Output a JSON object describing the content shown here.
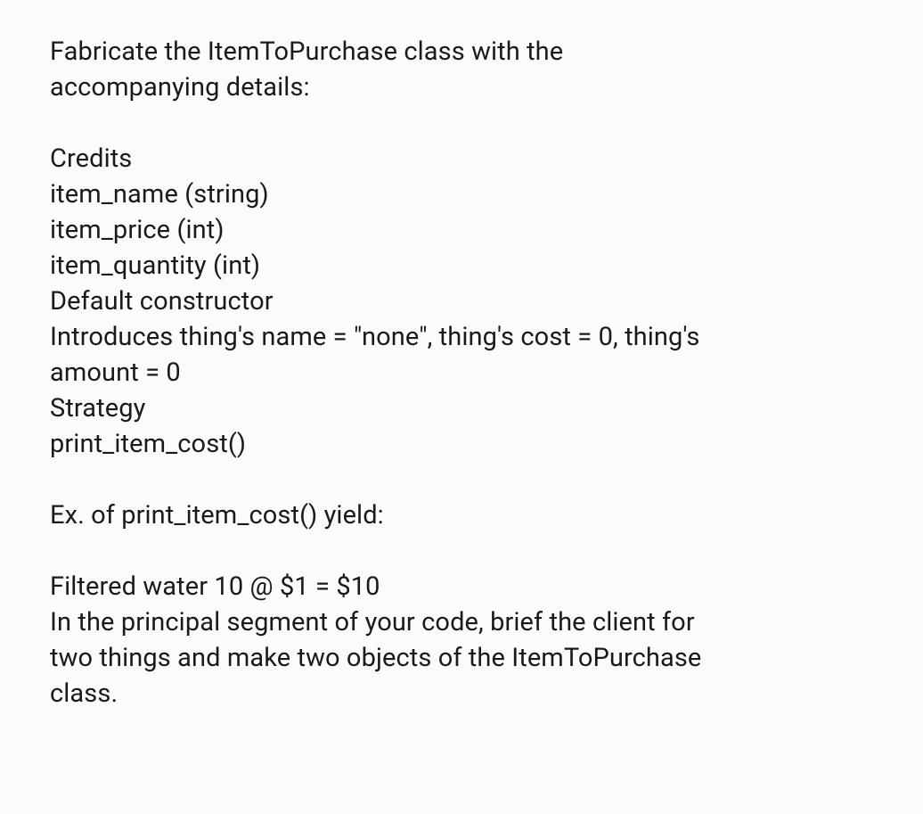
{
  "para1": {
    "line1": "Fabricate the ItemToPurchase class with the",
    "line2": "accompanying details:"
  },
  "para2": {
    "line1": "Credits",
    "line2": "item_name (string)",
    "line3": "item_price (int)",
    "line4": "item_quantity (int)",
    "line5": "Default constructor",
    "line6": "Introduces thing's name = \"none\", thing's cost = 0, thing's",
    "line7": "amount = 0",
    "line8": "Strategy",
    "line9": "print_item_cost()"
  },
  "para3": {
    "line1": "Ex. of print_item_cost() yield:"
  },
  "para4": {
    "line1": "Filtered water 10 @ $1 = $10",
    "line2": "In the principal segment of your code, brief the client for",
    "line3": "two things and make two objects of the ItemToPurchase",
    "line4": "class."
  }
}
